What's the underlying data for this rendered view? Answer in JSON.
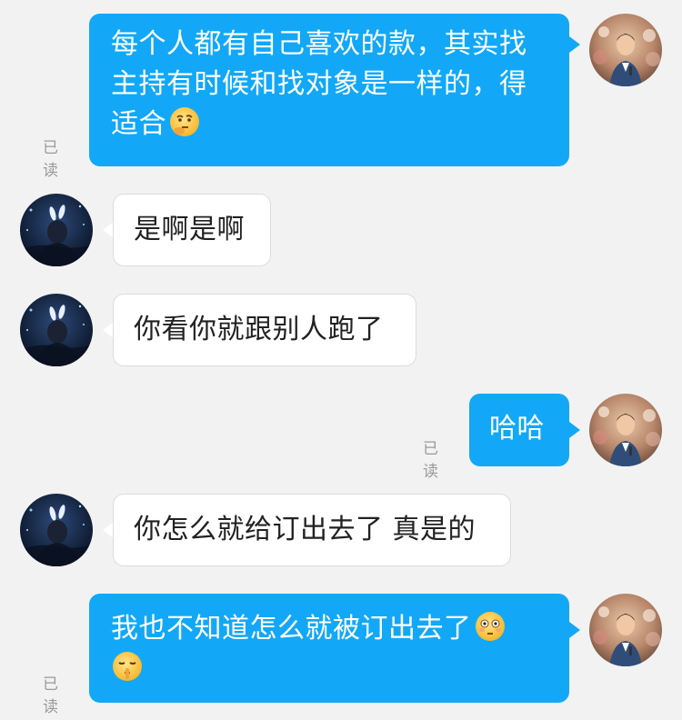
{
  "colors": {
    "background": "#f2f2f2",
    "outgoing_bubble": "#12a8f7",
    "incoming_bubble": "#ffffff",
    "read_status": "#9a9a9a"
  },
  "messages": [
    {
      "direction": "outgoing",
      "text": "每个人都有自己喜欢的款，其实找主持有时候和找对象是一样的，得适合",
      "emoji": "thinking-face-icon",
      "status": "已读",
      "avatar": "avatar-host-icon"
    },
    {
      "direction": "incoming",
      "text": "是啊是啊",
      "avatar": "avatar-bunny-ears-icon"
    },
    {
      "direction": "incoming",
      "text": "你看你就跟别人跑了",
      "avatar": "avatar-bunny-ears-icon"
    },
    {
      "direction": "outgoing",
      "text": "哈哈",
      "status": "已读",
      "avatar": "avatar-host-icon"
    },
    {
      "direction": "incoming",
      "text": "你怎么就给订出去了 真是的",
      "avatar": "avatar-bunny-ears-icon"
    },
    {
      "direction": "outgoing",
      "text": "我也不知道怎么就被订出去了",
      "emoji": "flushed-face-icon",
      "emoji2": "shushing-face-icon",
      "status": "已读",
      "avatar": "avatar-host-icon"
    }
  ]
}
